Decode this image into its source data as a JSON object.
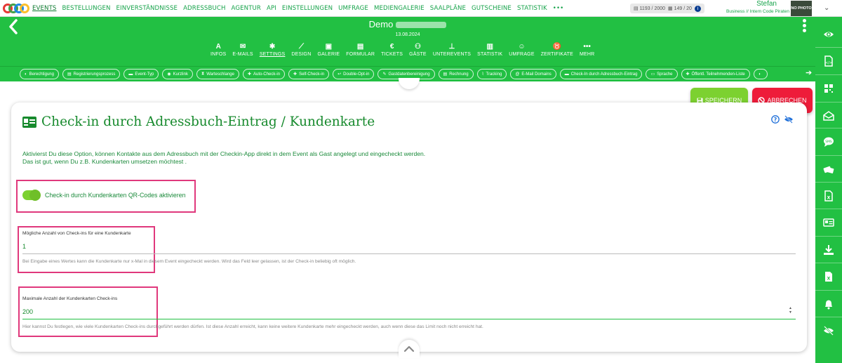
{
  "topnav": {
    "links": [
      "EVENTS",
      "BESTELLUNGEN",
      "EINVERSTÄNDNISSE",
      "ADRESSBUCH",
      "AGENTUR",
      "API",
      "EINSTELLUNGEN",
      "UMFRAGE",
      "MEDIENGALERIE",
      "SAALPLÄNE",
      "GUTSCHEINE",
      "STATISTIK",
      "•••"
    ],
    "active_index": 0,
    "counter_1": "1193 / 2000",
    "counter_2": "149 / 20",
    "user_name": "Stefan",
    "user_info": "Business // Intern Code Piraten",
    "avatar_text": "NO PHOTO"
  },
  "header": {
    "event_title": "Demo",
    "event_date": "13.08.2024",
    "tabs": [
      {
        "label": "INFOS",
        "icon": "font-a-icon"
      },
      {
        "label": "E-MAILS",
        "icon": "envelope-icon"
      },
      {
        "label": "SETTINGS",
        "icon": "gear-icon",
        "active": true
      },
      {
        "label": "DESIGN",
        "icon": "brush-icon"
      },
      {
        "label": "GALERIE",
        "icon": "images-icon"
      },
      {
        "label": "FORMULAR",
        "icon": "form-icon"
      },
      {
        "label": "TICKETS",
        "icon": "euro-icon"
      },
      {
        "label": "GÄSTE",
        "icon": "users-icon"
      },
      {
        "label": "UNTEREVENTS",
        "icon": "sitemap-icon"
      },
      {
        "label": "STATISTIK",
        "icon": "chart-icon"
      },
      {
        "label": "UMFRAGE",
        "icon": "smiley-icon"
      },
      {
        "label": "ZERTIFIKATE",
        "icon": "medal-icon"
      },
      {
        "label": "MEHR",
        "icon": "more-icon"
      }
    ]
  },
  "subnav": {
    "chips": [
      {
        "label": "Berechtigung",
        "icon": "◐"
      },
      {
        "label": "Registrierungsprozess",
        "icon": "▤"
      },
      {
        "label": "Event-Typ",
        "icon": "▬"
      },
      {
        "label": "Kurzlink",
        "icon": "◉"
      },
      {
        "label": "Warteschlange",
        "icon": "⧗"
      },
      {
        "label": "Auto-Check-in",
        "icon": "✚"
      },
      {
        "label": "Self-Check-in",
        "icon": "✚"
      },
      {
        "label": "Double-Opt-in",
        "icon": "↩"
      },
      {
        "label": "Gastdatenbereinigung",
        "icon": "✎"
      },
      {
        "label": "Rechnung",
        "icon": "▤"
      },
      {
        "label": "Tracking",
        "icon": "⌇"
      },
      {
        "label": "E-Mail Domains",
        "icon": "@"
      },
      {
        "label": "Check-In durch Adressbuch-Eintrag",
        "icon": "▬"
      },
      {
        "label": "Sprache",
        "icon": "▭"
      },
      {
        "label": "Öffentl. Teilnehmenden-Liste",
        "icon": "✚"
      },
      {
        "label": "",
        "icon": "◗"
      }
    ]
  },
  "actions": {
    "save": "SPEICHERN",
    "cancel": "ABBRECHEN"
  },
  "card": {
    "title": "Check-in durch Adressbuch-Eintrag / Kundenkarte",
    "description_1": "Aktivierst Du diese Option, können Kontakte aus dem Adressbuch mit der Checkin-App direkt in dem Event als Gast angelegt und eingecheckt werden.",
    "description_2": "Das ist gut, wenn Du z.B. Kundenkarten umsetzen möchtest .",
    "toggle_label": "Check-in durch Kundenkarten QR-Codes aktivieren",
    "toggle_on": true,
    "field_1": {
      "label": "Mögliche Anzahl von Check-ins für eine Kundenkarte",
      "value": "1",
      "hint": "Bei Eingabe eines Wertes kann die Kundenkarte nur x-Mal in diesem Event eingecheckt werden. Wird das Feld leer gelassen, ist der Check-in beliebig oft möglich."
    },
    "field_2": {
      "label": "Maximale Anzahl der Kundenkarten Check-ins",
      "value": "200",
      "hint": "Hier kannst Du festlegen, wie viele Kundenkarten Check-ins durchgeführt werden dürfen. Ist diese Anzahl erreicht, kann keine weitere Kundenkarte mehr eingecheckt werden, auch wenn diese das Limit noch nicht erreicht hat."
    }
  },
  "sidebar_icons": [
    "eye-icon",
    "code-file-icon",
    "qr-code-icon",
    "envelope-open-icon",
    "sms-icon",
    "tickets-icon",
    "excel-file-icon",
    "id-card-icon",
    "download-icon",
    "excel-export-icon",
    "bell-icon",
    "eye-slash-icon"
  ],
  "colors": {
    "brand_green": "#22c043",
    "save_green": "#7cd130",
    "cancel_red": "#ee1c3a",
    "highlight_pink": "#e0387c"
  }
}
